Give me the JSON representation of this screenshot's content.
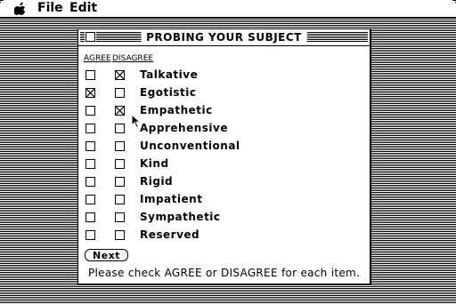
{
  "menubar": {
    "apple_icon": "apple-icon",
    "file_label": "File",
    "edit_label": "Edit"
  },
  "window": {
    "title": "PROBING YOUR SUBJECT"
  },
  "headers": {
    "agree": "AGREE",
    "disagree": "DISAGREE"
  },
  "items": [
    {
      "label": "Talkative",
      "agree": false,
      "disagree": true
    },
    {
      "label": "Egotistic",
      "agree": true,
      "disagree": false
    },
    {
      "label": "Empathetic",
      "agree": false,
      "disagree": true
    },
    {
      "label": "Apprehensive",
      "agree": false,
      "disagree": false
    },
    {
      "label": "Unconventional",
      "agree": false,
      "disagree": false
    },
    {
      "label": "Kind",
      "agree": false,
      "disagree": false
    },
    {
      "label": "Rigid",
      "agree": false,
      "disagree": false
    },
    {
      "label": "Impatient",
      "agree": false,
      "disagree": false
    },
    {
      "label": "Sympathetic",
      "agree": false,
      "disagree": false
    },
    {
      "label": "Reserved",
      "agree": false,
      "disagree": false
    }
  ],
  "next_button": {
    "label": "Next"
  },
  "instruction": "Please check AGREE or DISAGREE for each item.",
  "cursor_icon": "arrow-cursor-icon"
}
